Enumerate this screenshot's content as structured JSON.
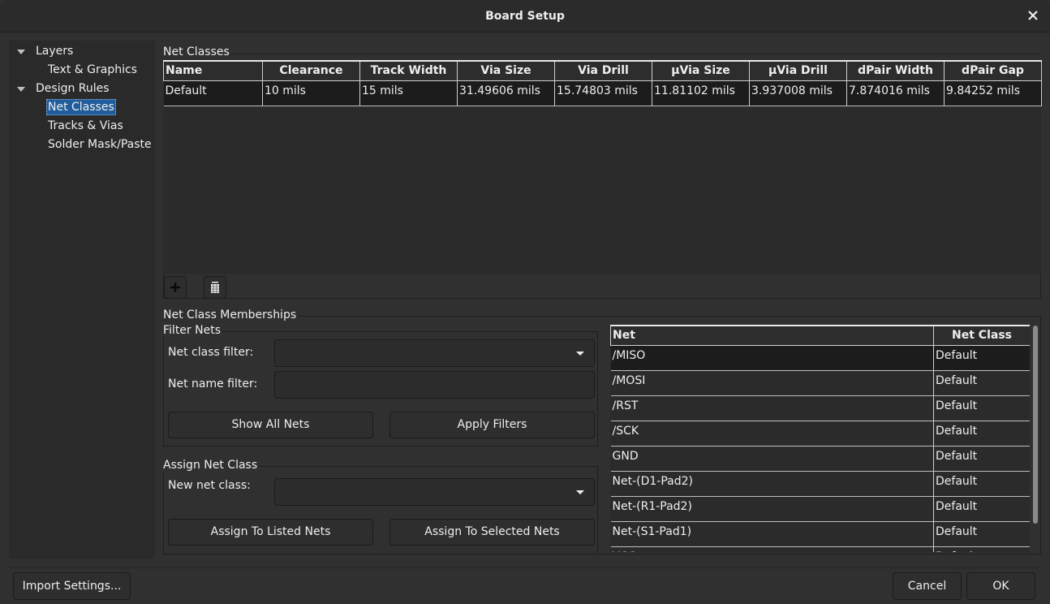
{
  "window": {
    "title": "Board Setup",
    "close_icon": "close-icon"
  },
  "sidebar": {
    "items": [
      {
        "label": "Layers",
        "level": 0,
        "expanded": true
      },
      {
        "label": "Text & Graphics",
        "level": 1
      },
      {
        "label": "Design Rules",
        "level": 0,
        "expanded": true
      },
      {
        "label": "Net Classes",
        "level": 1,
        "selected": true
      },
      {
        "label": "Tracks & Vias",
        "level": 1
      },
      {
        "label": "Solder Mask/Paste",
        "level": 1
      }
    ]
  },
  "net_classes": {
    "group_label": "Net Classes",
    "columns": [
      "Name",
      "Clearance",
      "Track Width",
      "Via Size",
      "Via Drill",
      "µVia Size",
      "µVia Drill",
      "dPair Width",
      "dPair Gap"
    ],
    "rows": [
      [
        "Default",
        "10 mils",
        "15 mils",
        "31.49606 mils",
        "15.74803 mils",
        "11.81102 mils",
        "3.937008 mils",
        "7.874016 mils",
        "9.84252 mils"
      ]
    ],
    "add_icon": "plus-icon",
    "delete_icon": "trash-icon"
  },
  "memberships": {
    "group_label": "Net Class Memberships",
    "filter": {
      "group_label": "Filter Nets",
      "net_class_filter_label": "Net class filter:",
      "net_class_filter_value": "",
      "net_name_filter_label": "Net name filter:",
      "net_name_filter_value": "",
      "show_all_label": "Show All Nets",
      "apply_label": "Apply Filters"
    },
    "assign": {
      "group_label": "Assign Net Class",
      "new_class_label": "New net class:",
      "new_class_value": "",
      "assign_listed_label": "Assign To Listed Nets",
      "assign_selected_label": "Assign To Selected Nets"
    },
    "nets_table": {
      "columns": [
        "Net",
        "Net Class"
      ],
      "rows": [
        [
          "/MISO",
          "Default"
        ],
        [
          "/MOSI",
          "Default"
        ],
        [
          "/RST",
          "Default"
        ],
        [
          "/SCK",
          "Default"
        ],
        [
          "GND",
          "Default"
        ],
        [
          "Net-(D1-Pad2)",
          "Default"
        ],
        [
          "Net-(R1-Pad2)",
          "Default"
        ],
        [
          "Net-(S1-Pad1)",
          "Default"
        ],
        [
          "VCC",
          "Default"
        ]
      ]
    }
  },
  "footer": {
    "import_label": "Import Settings...",
    "cancel_label": "Cancel",
    "ok_label": "OK"
  }
}
